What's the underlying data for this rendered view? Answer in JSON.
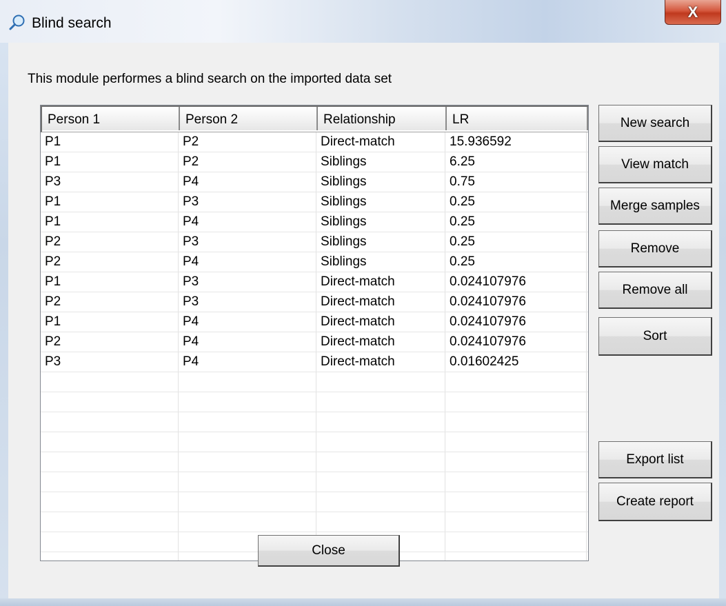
{
  "window": {
    "title": "Blind search",
    "close_glyph": "X"
  },
  "description": "This module performes a blind search on the imported data set",
  "table": {
    "columns": [
      "Person 1",
      "Person 2",
      "Relationship",
      "LR"
    ],
    "rows": [
      [
        "P1",
        "P2",
        "Direct-match",
        "15.936592"
      ],
      [
        "P1",
        "P2",
        "Siblings",
        "6.25"
      ],
      [
        "P3",
        "P4",
        "Siblings",
        "0.75"
      ],
      [
        "P1",
        "P3",
        "Siblings",
        "0.25"
      ],
      [
        "P1",
        "P4",
        "Siblings",
        "0.25"
      ],
      [
        "P2",
        "P3",
        "Siblings",
        "0.25"
      ],
      [
        "P2",
        "P4",
        "Siblings",
        "0.25"
      ],
      [
        "P1",
        "P3",
        "Direct-match",
        "0.024107976"
      ],
      [
        "P2",
        "P3",
        "Direct-match",
        "0.024107976"
      ],
      [
        "P1",
        "P4",
        "Direct-match",
        "0.024107976"
      ],
      [
        "P2",
        "P4",
        "Direct-match",
        "0.024107976"
      ],
      [
        "P3",
        "P4",
        "Direct-match",
        "0.01602425"
      ]
    ]
  },
  "buttons": {
    "new_search": "New search",
    "view_match": "View match",
    "merge_samples": "Merge samples",
    "remove": "Remove",
    "remove_all": "Remove all",
    "sort": "Sort",
    "export_list": "Export list",
    "create_report": "Create report",
    "close": "Close"
  },
  "icons": {
    "title_icon": "magnifier-icon"
  }
}
